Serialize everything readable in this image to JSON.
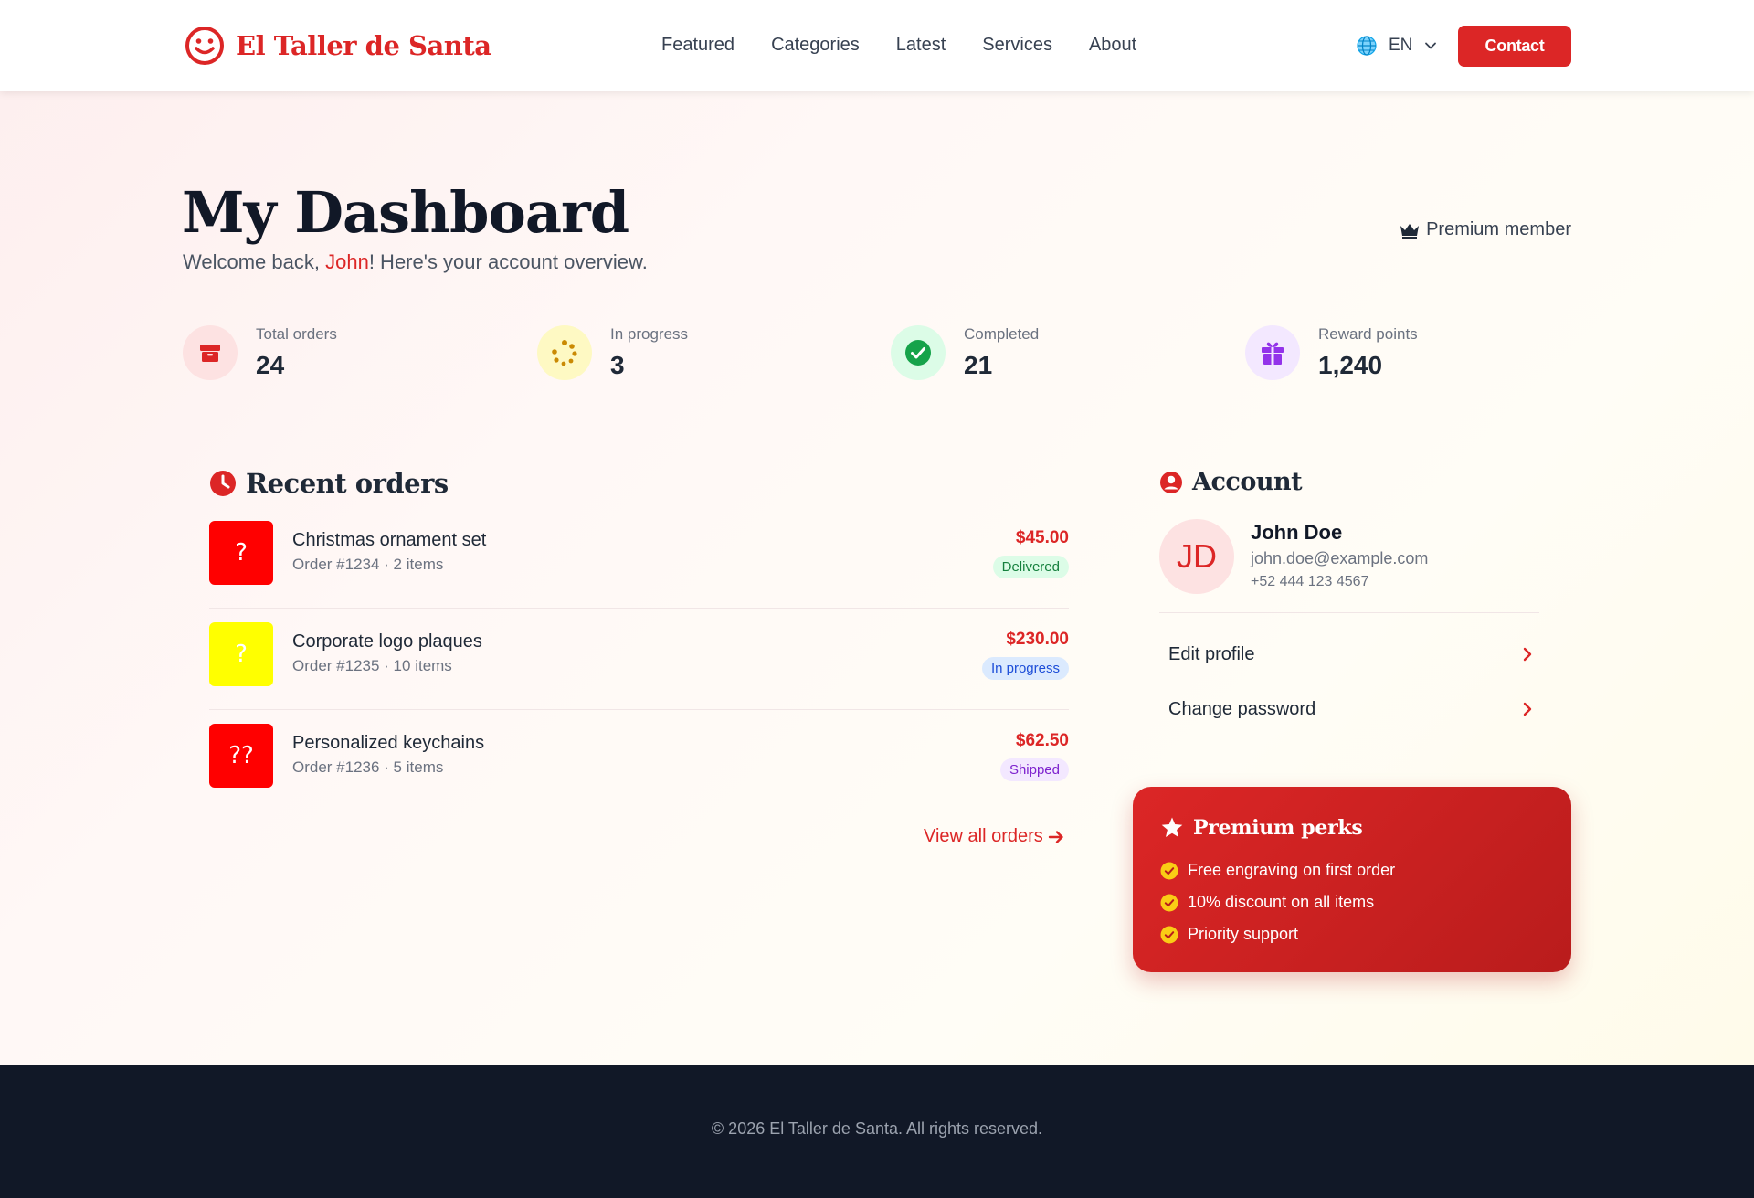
{
  "header": {
    "brand": "El Taller de Santa",
    "nav": [
      "Featured",
      "Categories",
      "Latest",
      "Services",
      "About"
    ],
    "language": "EN",
    "contact_label": "Contact"
  },
  "hero": {
    "title": "My Dashboard",
    "welcome_prefix": "Welcome back, ",
    "user_first_name": "John",
    "welcome_suffix": "! Here's your account overview.",
    "membership": "Premium member"
  },
  "stats": [
    {
      "label": "Total orders",
      "value": "24",
      "icon": "box-icon",
      "color": "#dc2626",
      "bg": "#fde2e2"
    },
    {
      "label": "In progress",
      "value": "3",
      "icon": "spinner-icon",
      "color": "#ca8a04",
      "bg": "#fef9c3"
    },
    {
      "label": "Completed",
      "value": "21",
      "icon": "check-circle-icon",
      "color": "#16a34a",
      "bg": "#dcfce7"
    },
    {
      "label": "Reward points",
      "value": "1,240",
      "icon": "gift-icon",
      "color": "#9333ea",
      "bg": "#f3e8ff"
    }
  ],
  "orders": {
    "title": "Recent orders",
    "items": [
      {
        "name": "Christmas ornament set",
        "meta": "Order #1234 · 2 items",
        "price": "$45.00",
        "status": "Delivered",
        "thumb_glyph": "?",
        "thumb_color": "#ff0000",
        "status_bg": "#dcfce7",
        "status_color": "#15803d"
      },
      {
        "name": "Corporate logo plaques",
        "meta": "Order #1235 · 10 items",
        "price": "$230.00",
        "status": "In progress",
        "thumb_glyph": "?",
        "thumb_color": "#ffff00",
        "status_bg": "#dbeafe",
        "status_color": "#1d4ed8"
      },
      {
        "name": "Personalized keychains",
        "meta": "Order #1236 · 5 items",
        "price": "$62.50",
        "status": "Shipped",
        "thumb_glyph": "??",
        "thumb_color": "#ff0000",
        "status_bg": "#f3e8ff",
        "status_color": "#7e22ce"
      }
    ],
    "view_all": "View all orders"
  },
  "account": {
    "title": "Account",
    "initials": "JD",
    "name": "John Doe",
    "email": "john.doe@example.com",
    "phone": "+52 444 123 4567",
    "links": [
      "Edit profile",
      "Change password"
    ]
  },
  "perks": {
    "title": "Premium perks",
    "items": [
      "Free engraving on first order",
      "10% discount on all items",
      "Priority support"
    ]
  },
  "footer": {
    "copyright": "© 2026 El Taller de Santa. All rights reserved."
  },
  "colors": {
    "accent": "#dc2626",
    "footer_bg": "#111827",
    "check": "#facc15"
  }
}
